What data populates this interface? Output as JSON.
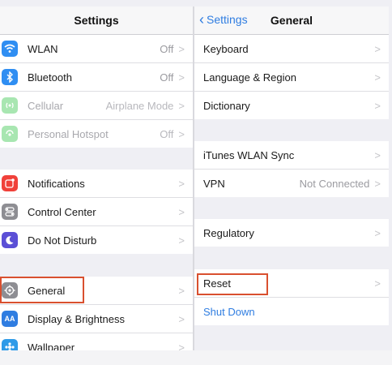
{
  "left": {
    "title": "Settings",
    "items": [
      {
        "label": "WLAN",
        "value": "Off",
        "icon": "wifi-icon",
        "color": "#2f8ef2"
      },
      {
        "label": "Bluetooth",
        "value": "Off",
        "icon": "bluetooth-icon",
        "color": "#2f8ef2"
      },
      {
        "label": "Cellular",
        "value": "Airplane Mode",
        "icon": "cellular-icon",
        "color": "#7fd88f"
      },
      {
        "label": "Personal Hotspot",
        "value": "Off",
        "icon": "hotspot-icon",
        "color": "#7fd88f"
      },
      {
        "label": "Notifications",
        "value": "",
        "icon": "notifications-icon",
        "color": "#f0413a"
      },
      {
        "label": "Control Center",
        "value": "",
        "icon": "control-center-icon",
        "color": "#8e8e93"
      },
      {
        "label": "Do Not Disturb",
        "value": "",
        "icon": "moon-icon",
        "color": "#5b4fd6"
      },
      {
        "label": "General",
        "value": "",
        "icon": "gear-icon",
        "color": "#8e8e93"
      },
      {
        "label": "Display & Brightness",
        "value": "",
        "icon": "text-size-icon",
        "color": "#2f7de1"
      },
      {
        "label": "Wallpaper",
        "value": "",
        "icon": "wallpaper-icon",
        "color": "#2f9be8"
      }
    ]
  },
  "right": {
    "back_label": "Settings",
    "title": "General",
    "items": [
      {
        "label": "Keyboard",
        "value": ""
      },
      {
        "label": "Language & Region",
        "value": ""
      },
      {
        "label": "Dictionary",
        "value": ""
      },
      {
        "label": "iTunes WLAN Sync",
        "value": ""
      },
      {
        "label": "VPN",
        "value": "Not Connected"
      },
      {
        "label": "Regulatory",
        "value": ""
      },
      {
        "label": "Reset",
        "value": ""
      },
      {
        "label": "Shut Down",
        "value": ""
      }
    ]
  },
  "highlight_color": "#d9502f"
}
